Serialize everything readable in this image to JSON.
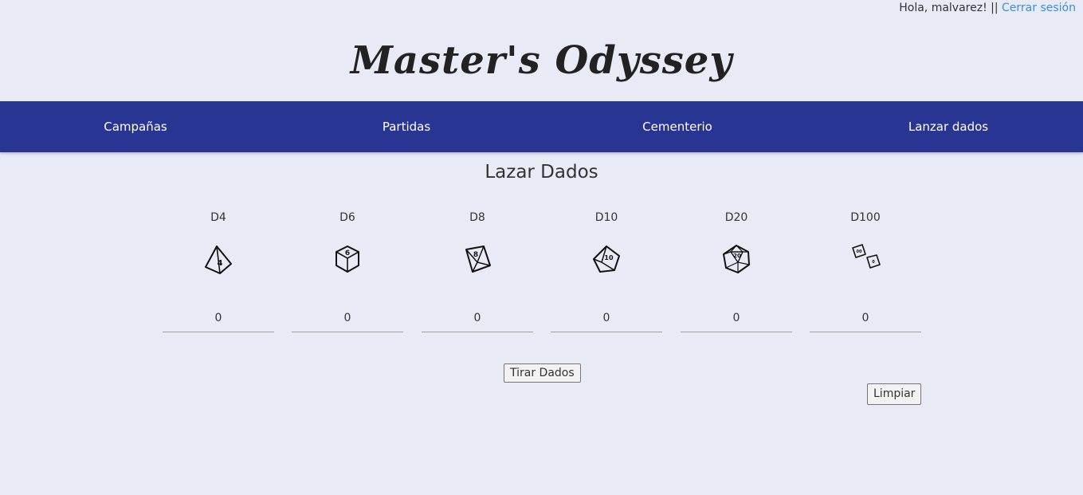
{
  "header": {
    "greeting": "Hola, malvarez! ||",
    "logout_link": "Cerrar sesión",
    "site_title": "Master's Odyssey"
  },
  "nav": {
    "items": [
      {
        "label": "Campañas"
      },
      {
        "label": "Partidas"
      },
      {
        "label": "Cementerio"
      },
      {
        "label": "Lanzar dados"
      }
    ],
    "background_color": "#283593"
  },
  "main": {
    "title": "Lazar Dados",
    "dice": [
      {
        "label": "D4",
        "icon": "d4-die-icon",
        "count": "0"
      },
      {
        "label": "D6",
        "icon": "d6-die-icon",
        "count": "0"
      },
      {
        "label": "D8",
        "icon": "d8-die-icon",
        "count": "0"
      },
      {
        "label": "D10",
        "icon": "d10-die-icon",
        "count": "0"
      },
      {
        "label": "D20",
        "icon": "d20-die-icon",
        "count": "0"
      },
      {
        "label": "D100",
        "icon": "d100-dice-icon",
        "count": "0"
      }
    ],
    "roll_button": "Tirar Dados",
    "clear_button": "Limpiar"
  },
  "colors": {
    "page_background": "#e8eaf6",
    "link": "#3a8fd6"
  }
}
